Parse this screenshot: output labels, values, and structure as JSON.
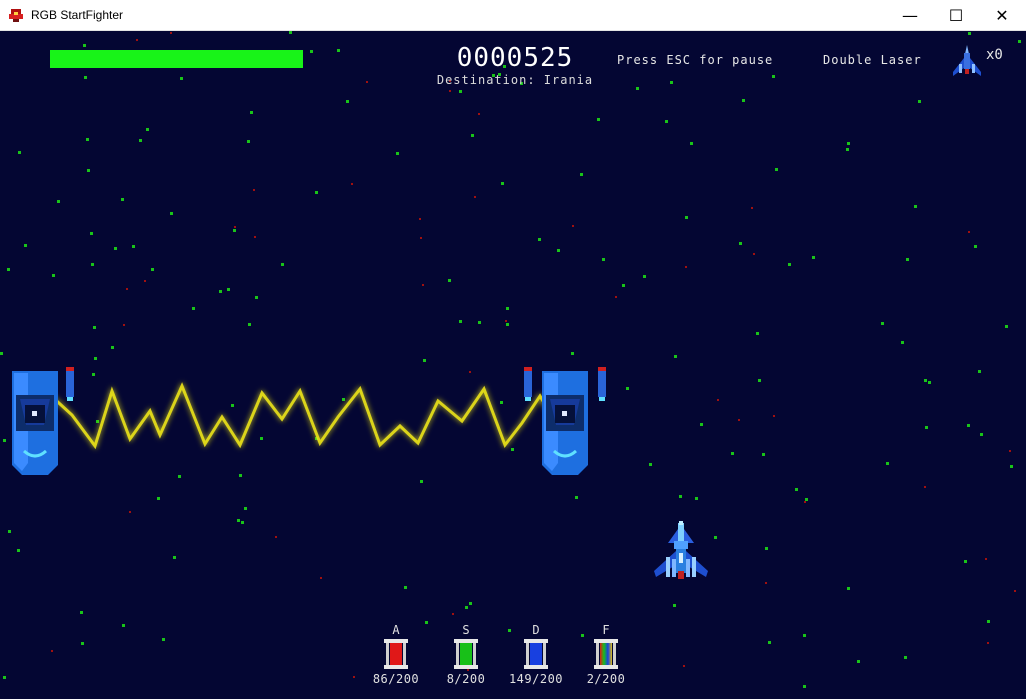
{
  "window": {
    "title": "RGB StartFighter",
    "minimize_glyph": "—",
    "maximize_glyph": "☐",
    "close_glyph": "✕"
  },
  "hud": {
    "health_fraction": 1.0,
    "health_color": "#18f318",
    "score": "0000525",
    "destination": "Destination: Irania",
    "pause_hint": "Press ESC for pause",
    "weapon": "Double Laser",
    "lives": "x0"
  },
  "resources": [
    {
      "key": "A",
      "value": "86/200",
      "color": "#e01818"
    },
    {
      "key": "S",
      "value": "8/200",
      "color": "#18c018"
    },
    {
      "key": "D",
      "value": "149/200",
      "color": "#1840e0"
    },
    {
      "key": "F",
      "value": "2/200",
      "color": "rainbow"
    }
  ],
  "colors": {
    "space": "#040633",
    "laser": "#f2ea1a",
    "turret_blue": "#1e6fe0",
    "star_green": "#19c419",
    "star_red": "#a01010"
  }
}
